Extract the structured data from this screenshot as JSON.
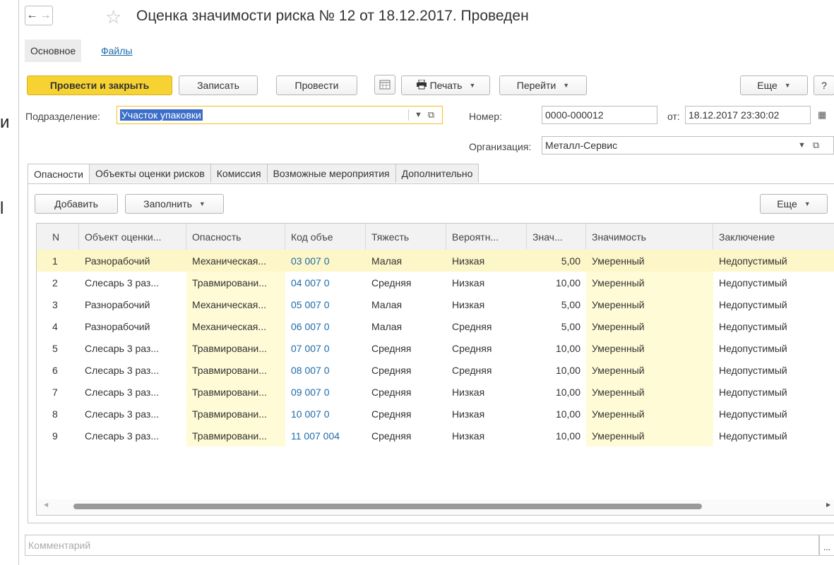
{
  "edge": {
    "top_char": "и",
    "bottom_char": "l"
  },
  "window": {
    "title": "Оценка значимости риска № 12 от 18.12.2017. Проведен"
  },
  "nav": {
    "back": "←",
    "forward": "→",
    "star": "☆"
  },
  "tabs_top": {
    "basic": "Основное",
    "files": "Файлы"
  },
  "toolbar": {
    "post_close": "Провести и закрыть",
    "save": "Записать",
    "post": "Провести",
    "print": "Печать",
    "goto": "Перейти",
    "more": "Еще",
    "help": "?"
  },
  "form": {
    "division_label": "Подразделение:",
    "division_value": "Участок упаковки",
    "number_label": "Номер:",
    "number_value": "0000-000012",
    "date_label": "от:",
    "date_value": "18.12.2017 23:30:02",
    "org_label": "Организация:",
    "org_value": "Металл-Сервис"
  },
  "subtabs": [
    "Опасности",
    "Объекты оценки рисков",
    "Комиссия",
    "Возможные мероприятия",
    "Дополнительно"
  ],
  "table_toolbar": {
    "add": "Добавить",
    "fill": "Заполнить",
    "more": "Еще"
  },
  "table": {
    "columns": [
      "N",
      "Объект оценки...",
      "Опасность",
      "Код объе",
      "Тяжесть",
      "Вероятн...",
      "Знач...",
      "Значимость",
      "Заключение"
    ],
    "rows": [
      [
        "1",
        "Разнорабочий",
        "Механическая...",
        "03 007 0",
        "Малая",
        "Низкая",
        "5,00",
        "Умеренный",
        "Недопустимый"
      ],
      [
        "2",
        "Слесарь 3 раз...",
        "Травмировани...",
        "04 007 0",
        "Средняя",
        "Низкая",
        "10,00",
        "Умеренный",
        "Недопустимый"
      ],
      [
        "3",
        "Разнорабочий",
        "Механическая...",
        "05 007 0",
        "Малая",
        "Низкая",
        "5,00",
        "Умеренный",
        "Недопустимый"
      ],
      [
        "4",
        "Разнорабочий",
        "Механическая...",
        "06 007 0",
        "Малая",
        "Средняя",
        "5,00",
        "Умеренный",
        "Недопустимый"
      ],
      [
        "5",
        "Слесарь 3 раз...",
        "Травмировани...",
        "07 007 0",
        "Средняя",
        "Средняя",
        "10,00",
        "Умеренный",
        "Недопустимый"
      ],
      [
        "6",
        "Слесарь 3 раз...",
        "Травмировани...",
        "08 007 0",
        "Средняя",
        "Средняя",
        "10,00",
        "Умеренный",
        "Недопустимый"
      ],
      [
        "7",
        "Слесарь 3 раз...",
        "Травмировани...",
        "09 007 0",
        "Средняя",
        "Низкая",
        "10,00",
        "Умеренный",
        "Недопустимый"
      ],
      [
        "8",
        "Слесарь 3 раз...",
        "Травмировани...",
        "10 007 0",
        "Средняя",
        "Низкая",
        "10,00",
        "Умеренный",
        "Недопустимый"
      ],
      [
        "9",
        "Слесарь 3 раз...",
        "Травмировани...",
        "11 007 004",
        "Средняя",
        "Низкая",
        "10,00",
        "Умеренный",
        "Недопустимый"
      ]
    ]
  },
  "comment": {
    "placeholder": "Комментарий",
    "button": "..."
  },
  "colors": {
    "accent": "#f6d233",
    "link": "#1d6aa8",
    "highlight": "#fffbd6",
    "selected_row": "#fdf6c8"
  }
}
